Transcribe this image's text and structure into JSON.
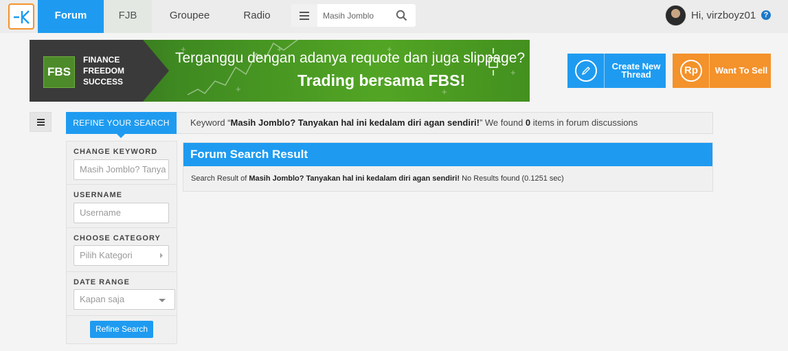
{
  "nav": {
    "items": [
      {
        "label": "Forum"
      },
      {
        "label": "FJB"
      },
      {
        "label": "Groupee"
      },
      {
        "label": "Radio"
      }
    ],
    "search_value": "Masih Jomblo",
    "user_greeting": "Hi, virzboyz01"
  },
  "banner": {
    "brand_box": "FBS",
    "brand_lines": [
      "FINANCE",
      "FREEDOM",
      "SUCCESS"
    ],
    "line1": "Terganggu dengan adanya requote dan juga slippage?",
    "line2": "Trading bersama FBS!"
  },
  "actions": {
    "create_label": "Create New Thread",
    "sell_icon": "Rp",
    "sell_label": "Want To Sell"
  },
  "refine": {
    "tab_label": "REFINE YOUR SEARCH",
    "keyword_prefix": "Keyword “",
    "keyword": "Masih Jomblo? Tanyakan hal ini kedalam diri agan sendiri!",
    "keyword_mid": "” We found ",
    "count": "0",
    "keyword_suffix": " items in forum discussions"
  },
  "sidebar": {
    "change_keyword_label": "CHANGE KEYWORD",
    "keyword_value": "Masih Jomblo? Tanya",
    "username_label": "USERNAME",
    "username_placeholder": "Username",
    "category_label": "CHOOSE CATEGORY",
    "category_placeholder": "Pilih Kategori",
    "date_label": "DATE RANGE",
    "date_value": "Kapan saja",
    "refine_button": "Refine Search"
  },
  "results": {
    "title": "Forum Search Result",
    "prefix": "Search Result of ",
    "query": "Masih Jomblo? Tanyakan hal ini kedalam diri agan sendiri!",
    "suffix": " No Results found (0.1251 sec)"
  },
  "colors": {
    "accent": "#1e9bf0",
    "orange": "#f4922b",
    "banner_green": "#52a524"
  }
}
